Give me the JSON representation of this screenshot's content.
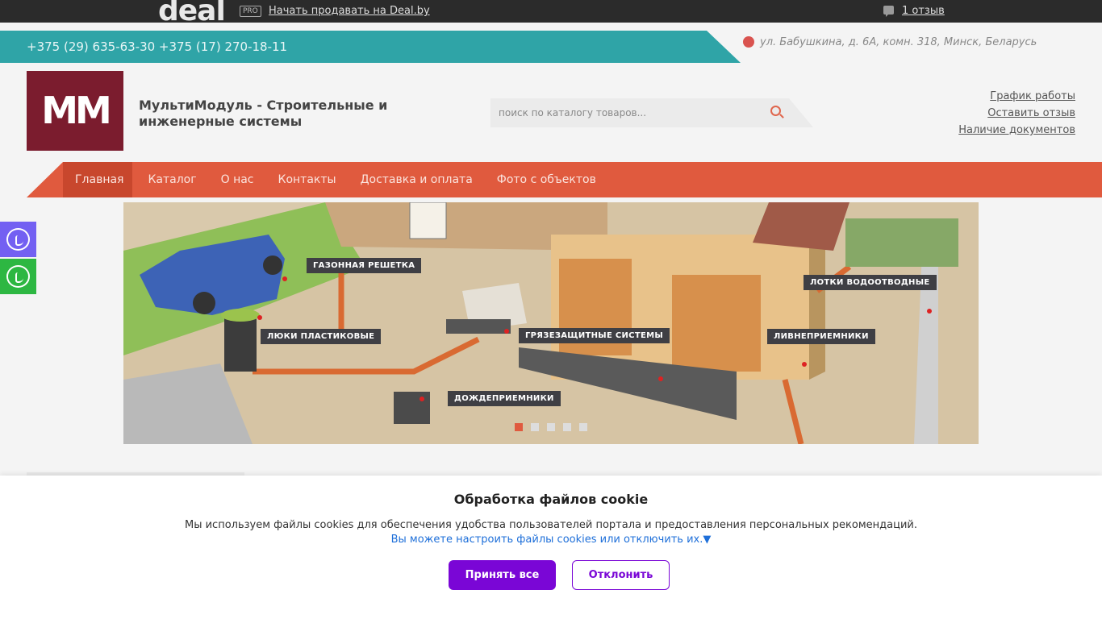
{
  "dealbar": {
    "logo": "deal",
    "pro_badge": "PRO",
    "sell_link": "Начать продавать на Deal.by",
    "reviews_link": "1 отзыв",
    "review_icon": "speech-bubble-icon"
  },
  "contact": {
    "phones": "+375 (29) 635-63-30 +375 (17) 270-18-11",
    "address": "ул. Бабушкина, д. 6А, комн. 318, Минск, Беларусь",
    "address_icon": "globe-icon"
  },
  "header": {
    "logo_text": "MM",
    "site_title": "МультиМодуль - Строительные и инженерные системы",
    "search_placeholder": "поиск по каталогу товаров...",
    "links": [
      "График работы",
      "Оставить отзыв",
      "Наличие документов"
    ]
  },
  "nav": {
    "items": [
      "Главная",
      "Каталог",
      "О нас",
      "Контакты",
      "Доставка и оплата",
      "Фото с объектов"
    ],
    "active": "Главная"
  },
  "banner": {
    "labels": [
      "ГАЗОННАЯ РЕШЕТКА",
      "ЛЮКИ ПЛАСТИКОВЫЕ",
      "ГРЯЗЕЗАЩИТНЫЕ СИСТЕМЫ",
      "ЛИВНЕПРИЕМНИКИ",
      "ЛОТКИ ВОДООТВОДНЫЕ",
      "ДОЖДЕПРИЕМНИКИ"
    ],
    "slides_total": 5,
    "active_slide": 1
  },
  "messengers": [
    "viber-icon",
    "whatsapp-icon"
  ],
  "cookie": {
    "title": "Обработка файлов cookie",
    "text": "Мы используем файлы cookies для обеспечения удобства пользователей портала и предоставления персональных рекомендаций.",
    "settings_link": "Вы можете настроить файлы cookies или отключить их.▼",
    "accept": "Принять все",
    "decline": "Отклонить"
  },
  "colors": {
    "accent_orange": "#e05a3e",
    "teal": "#2fa4a7",
    "brand_red": "#7b1c2e",
    "cookie_purple": "#7a06d6"
  }
}
